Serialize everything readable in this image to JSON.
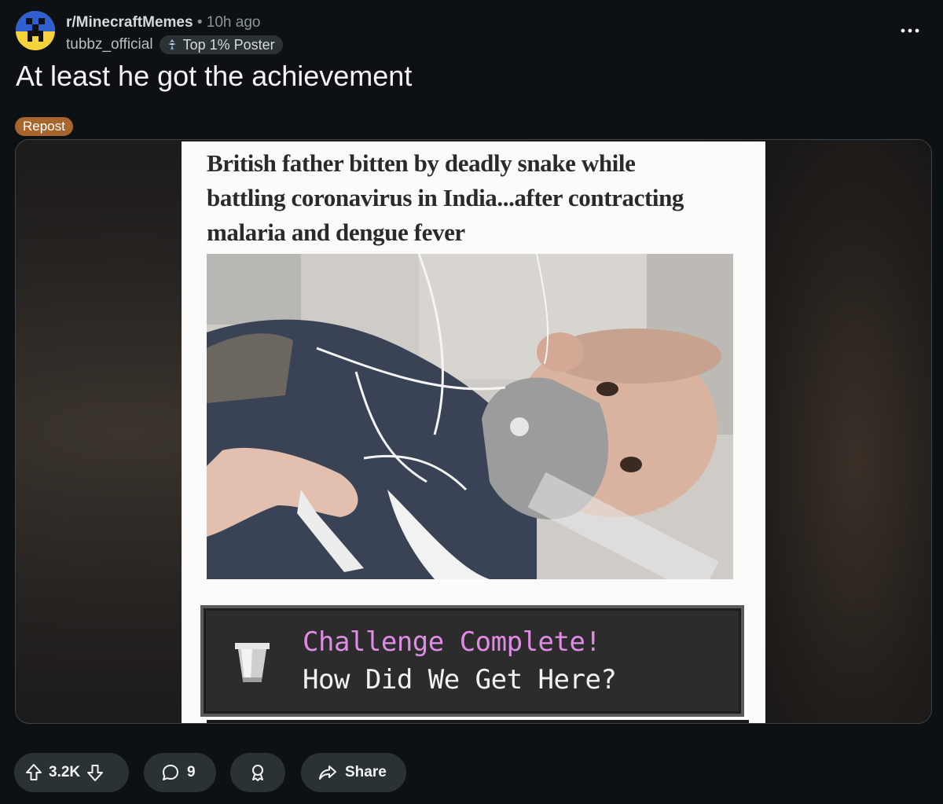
{
  "post": {
    "subreddit": "r/MinecraftMemes",
    "separator": "•",
    "time_ago": "10h ago",
    "author": "tubbz_official",
    "author_flair": "Top 1% Poster",
    "title": "At least he got the achievement",
    "tag": "Repost"
  },
  "meme": {
    "headline": "British father bitten by deadly snake while battling coronavirus in India...after contracting malaria and dengue fever",
    "achievement_title": "Challenge Complete!",
    "achievement_desc": "How Did We Get Here?"
  },
  "actions": {
    "upvotes": "3.2K",
    "comments": "9",
    "share_label": "Share"
  },
  "icons": {
    "overflow": "more-horizontal-icon",
    "upvote": "arrow-up-icon",
    "downvote": "arrow-down-icon",
    "comment": "comment-bubble-icon",
    "award": "award-icon",
    "share": "share-arrow-icon",
    "flair": "top-poster-icon"
  },
  "colors": {
    "background": "#0e1113",
    "pill": "#2a3236",
    "tag": "#a8662c",
    "achievement_title": "#e08ce6"
  }
}
